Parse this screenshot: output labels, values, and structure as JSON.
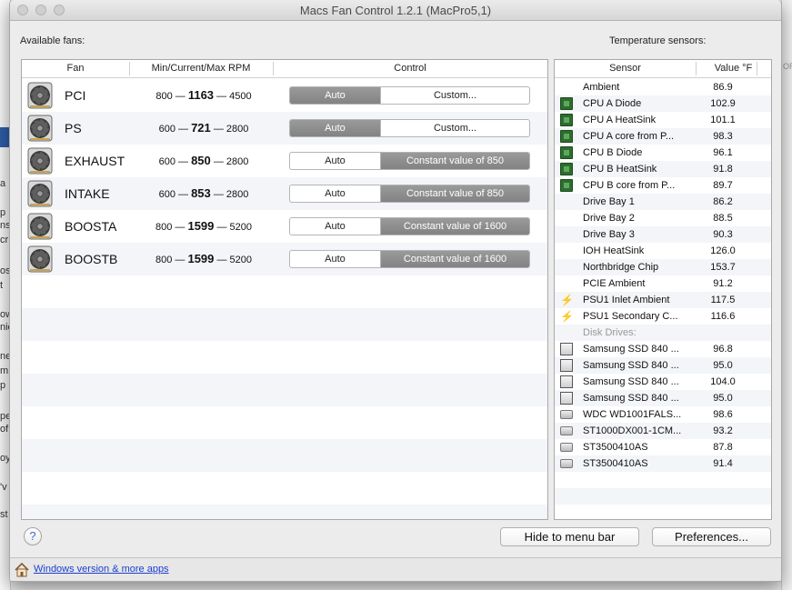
{
  "window": {
    "title": "Macs Fan Control 1.2.1 (MacPro5,1)"
  },
  "fans": {
    "section_label": "Available fans:",
    "columns": {
      "fan": "Fan",
      "rpm": "Min/Current/Max RPM",
      "control": "Control"
    },
    "rows": [
      {
        "name": "PCI",
        "min": "800",
        "current": "1163",
        "max": "4500",
        "auto": "Auto",
        "custom": "Custom...",
        "mode": "auto"
      },
      {
        "name": "PS",
        "min": "600",
        "current": "721",
        "max": "2800",
        "auto": "Auto",
        "custom": "Custom...",
        "mode": "auto"
      },
      {
        "name": "EXHAUST",
        "min": "600",
        "current": "850",
        "max": "2800",
        "auto": "Auto",
        "custom": "Constant value of 850",
        "mode": "custom"
      },
      {
        "name": "INTAKE",
        "min": "600",
        "current": "853",
        "max": "2800",
        "auto": "Auto",
        "custom": "Constant value of 850",
        "mode": "custom"
      },
      {
        "name": "BOOSTA",
        "min": "800",
        "current": "1599",
        "max": "5200",
        "auto": "Auto",
        "custom": "Constant value of 1600",
        "mode": "custom"
      },
      {
        "name": "BOOSTB",
        "min": "800",
        "current": "1599",
        "max": "5200",
        "auto": "Auto",
        "custom": "Constant value of 1600",
        "mode": "custom"
      }
    ]
  },
  "sensors": {
    "section_label": "Temperature sensors:",
    "columns": {
      "sensor": "Sensor",
      "value": "Value °F"
    },
    "rows": [
      {
        "icon": "none",
        "name": "Ambient",
        "value": "86.9"
      },
      {
        "icon": "chip-icon",
        "name": "CPU A Diode",
        "value": "102.9"
      },
      {
        "icon": "chip-icon",
        "name": "CPU A HeatSink",
        "value": "101.1"
      },
      {
        "icon": "chip-icon",
        "name": "CPU A core from P...",
        "value": "98.3"
      },
      {
        "icon": "chip-icon",
        "name": "CPU B Diode",
        "value": "96.1"
      },
      {
        "icon": "chip-icon",
        "name": "CPU B HeatSink",
        "value": "91.8"
      },
      {
        "icon": "chip-icon",
        "name": "CPU B core from P...",
        "value": "89.7"
      },
      {
        "icon": "none",
        "name": "Drive Bay 1",
        "value": "86.2"
      },
      {
        "icon": "none",
        "name": "Drive Bay 2",
        "value": "88.5"
      },
      {
        "icon": "none",
        "name": "Drive Bay 3",
        "value": "90.3"
      },
      {
        "icon": "none",
        "name": "IOH HeatSink",
        "value": "126.0"
      },
      {
        "icon": "none",
        "name": "Northbridge Chip",
        "value": "153.7"
      },
      {
        "icon": "none",
        "name": "PCIE Ambient",
        "value": "91.2"
      },
      {
        "icon": "lightning-icon",
        "name": "PSU1 Inlet Ambient",
        "value": "117.5"
      },
      {
        "icon": "lightning-icon",
        "name": "PSU1 Secondary C...",
        "value": "116.6"
      }
    ],
    "group_label": "Disk Drives:",
    "disk_rows": [
      {
        "icon": "ssd-icon",
        "name": "Samsung SSD 840 ...",
        "value": "96.8"
      },
      {
        "icon": "ssd-icon",
        "name": "Samsung SSD 840 ...",
        "value": "95.0"
      },
      {
        "icon": "ssd-icon",
        "name": "Samsung SSD 840 ...",
        "value": "104.0"
      },
      {
        "icon": "ssd-icon",
        "name": "Samsung SSD 840 ...",
        "value": "95.0"
      },
      {
        "icon": "hdd-icon",
        "name": "WDC WD1001FALS...",
        "value": "98.6"
      },
      {
        "icon": "hdd-icon",
        "name": "ST1000DX001-1CM...",
        "value": "93.2"
      },
      {
        "icon": "hdd-icon",
        "name": "ST3500410AS",
        "value": "87.8"
      },
      {
        "icon": "hdd-icon",
        "name": "ST3500410AS",
        "value": "91.4"
      }
    ]
  },
  "buttons": {
    "help": "?",
    "hide": "Hide to menu bar",
    "preferences": "Preferences..."
  },
  "footer": {
    "link": "Windows version & more apps"
  },
  "background": {
    "left_fragments": [
      "a",
      "p",
      "ns",
      "cr",
      "os",
      "t",
      "ow",
      "nic",
      "ne",
      "m",
      "p",
      "pe",
      "of",
      "oy",
      "'v",
      "st"
    ],
    "right_fragment": "OR"
  }
}
